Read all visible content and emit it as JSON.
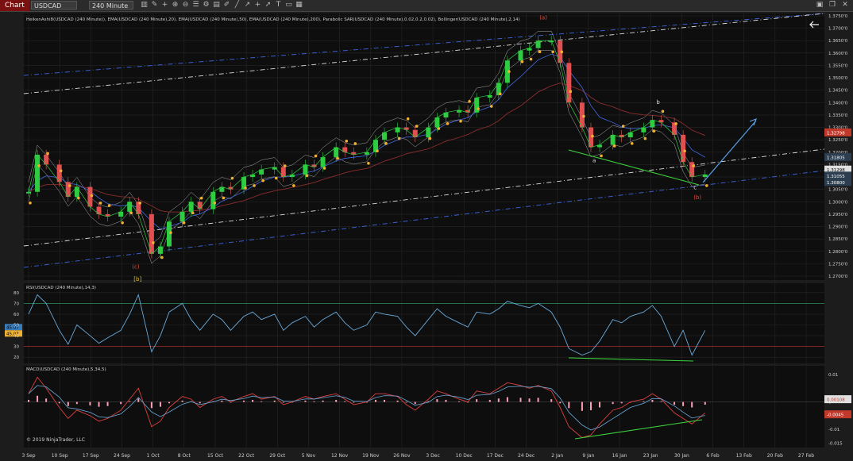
{
  "toolbar": {
    "tab_label": "Chart",
    "symbol": "USDCAD",
    "interval": "240 Minute",
    "icons": [
      "bar-chart-icon",
      "draw-icon",
      "crosshair-icon",
      "zoom-in-icon",
      "zoom-out-icon",
      "properties-icon",
      "strategy-icon",
      "template-icon",
      "pencil-icon",
      "line-icon",
      "ray-icon",
      "plus-icon",
      "arrow-icon",
      "text-icon",
      "shape-icon",
      "grid-icon"
    ],
    "window_icons": [
      "layout-icon",
      "restore-icon",
      "close-icon"
    ]
  },
  "price_panel": {
    "indicator_label": "HeikenAshi8(USDCAD (240 Minute)), EMA(USDCAD (240 Minute),20), EMA(USDCAD (240 Minute),50), EMA(USDCAD (240 Minute),200), Parabolic SAR(USDCAD (240 Minute),0.02,0.2,0.02), Bollinger(USDCAD (240 Minute),2,14)",
    "y_ticks": [
      "1.3750'0",
      "1.3700'0",
      "1.3650'0",
      "1.3600'0",
      "1.3550'0",
      "1.3500'0",
      "1.3450'0",
      "1.3400'0",
      "1.3350'0",
      "1.3300'0",
      "1.3250'0",
      "1.3200'0",
      "1.3150'0",
      "1.3100'0",
      "1.3050'0",
      "1.3000'0",
      "1.2950'0",
      "1.2900'0",
      "1.2850'0",
      "1.2800'0",
      "1.2750'0",
      "1.2700'0"
    ],
    "price_flags": [
      {
        "text": "1.32798",
        "color": "#c0392b",
        "value": 1.32798
      },
      {
        "text": "1.31805",
        "color": "#2c3e50",
        "value": 1.31805
      },
      {
        "text": "1.31298",
        "color": "#e0e0e0",
        "value": 1.31298
      },
      {
        "text": "1.31055",
        "color": "#2c3e50",
        "value": 1.31055
      },
      {
        "text": "1.30800",
        "color": "#2c3e50",
        "value": 1.308
      }
    ],
    "wave_labels": [
      {
        "text": "(a)",
        "color": "#e74c3c"
      },
      {
        "text": "(c)",
        "color": "#e74c3c"
      },
      {
        "text": "[b]",
        "color": "#f1c40f"
      },
      {
        "text": "a",
        "color": "#dddddd"
      },
      {
        "text": "b",
        "color": "#dddddd"
      },
      {
        "text": "c",
        "color": "#dddddd"
      },
      {
        "text": "(b)",
        "color": "#e74c3c"
      }
    ]
  },
  "rsi_panel": {
    "label": "RSI(USDCAD (240 Minute),14,3)",
    "y_ticks": [
      "80",
      "70",
      "60",
      "50",
      "40",
      "30",
      "20"
    ],
    "value_flags": [
      "45.07",
      "45.07"
    ]
  },
  "macd_panel": {
    "label": "MACD(USDCAD (240 Minute),5,34,5)",
    "y_ticks": [
      "0.01",
      "0",
      "-0.01",
      "-0.015"
    ],
    "value_flags": [
      "0.00108",
      "-0.0045"
    ],
    "copyright": "© 2019 NinjaTrader, LLC"
  },
  "x_axis": {
    "labels": [
      "3 Sep",
      "10 Sep",
      "17 Sep",
      "24 Sep",
      "1 Oct",
      "8 Oct",
      "15 Oct",
      "22 Oct",
      "29 Oct",
      "5 Nov",
      "12 Nov",
      "19 Nov",
      "26 Nov",
      "3 Dec",
      "10 Dec",
      "17 Dec",
      "24 Dec",
      "2 Jan",
      "9 Jan",
      "16 Jan",
      "23 Jan",
      "30 Jan",
      "6 Feb",
      "13 Feb",
      "20 Feb",
      "27 Feb"
    ]
  },
  "chart_data": {
    "type": "line",
    "symbol": "USDCAD",
    "interval": "240 Minute",
    "ylim": [
      1.27,
      1.375
    ],
    "price_series": [
      {
        "x": "3 Sep",
        "y": 1.304
      },
      {
        "x": "5 Sep",
        "y": 1.319
      },
      {
        "x": "7 Sep",
        "y": 1.315
      },
      {
        "x": "10 Sep",
        "y": 1.308
      },
      {
        "x": "12 Sep",
        "y": 1.302
      },
      {
        "x": "14 Sep",
        "y": 1.306
      },
      {
        "x": "17 Sep",
        "y": 1.298
      },
      {
        "x": "19 Sep",
        "y": 1.295
      },
      {
        "x": "21 Sep",
        "y": 1.294
      },
      {
        "x": "24 Sep",
        "y": 1.296
      },
      {
        "x": "26 Sep",
        "y": 1.3
      },
      {
        "x": "28 Sep",
        "y": 1.295
      },
      {
        "x": "1 Oct",
        "y": 1.279
      },
      {
        "x": "3 Oct",
        "y": 1.282
      },
      {
        "x": "5 Oct",
        "y": 1.292
      },
      {
        "x": "8 Oct",
        "y": 1.296
      },
      {
        "x": "10 Oct",
        "y": 1.3
      },
      {
        "x": "12 Oct",
        "y": 1.297
      },
      {
        "x": "15 Oct",
        "y": 1.304
      },
      {
        "x": "17 Oct",
        "y": 1.306
      },
      {
        "x": "19 Oct",
        "y": 1.305
      },
      {
        "x": "22 Oct",
        "y": 1.31
      },
      {
        "x": "24 Oct",
        "y": 1.311
      },
      {
        "x": "26 Oct",
        "y": 1.313
      },
      {
        "x": "29 Oct",
        "y": 1.314
      },
      {
        "x": "31 Oct",
        "y": 1.31
      },
      {
        "x": "2 Nov",
        "y": 1.311
      },
      {
        "x": "5 Nov",
        "y": 1.315
      },
      {
        "x": "7 Nov",
        "y": 1.314
      },
      {
        "x": "9 Nov",
        "y": 1.318
      },
      {
        "x": "12 Nov",
        "y": 1.322
      },
      {
        "x": "14 Nov",
        "y": 1.32
      },
      {
        "x": "16 Nov",
        "y": 1.319
      },
      {
        "x": "19 Nov",
        "y": 1.32
      },
      {
        "x": "21 Nov",
        "y": 1.325
      },
      {
        "x": "23 Nov",
        "y": 1.328
      },
      {
        "x": "26 Nov",
        "y": 1.33
      },
      {
        "x": "28 Nov",
        "y": 1.329
      },
      {
        "x": "30 Nov",
        "y": 1.326
      },
      {
        "x": "3 Dec",
        "y": 1.33
      },
      {
        "x": "5 Dec",
        "y": 1.334
      },
      {
        "x": "7 Dec",
        "y": 1.336
      },
      {
        "x": "10 Dec",
        "y": 1.337
      },
      {
        "x": "12 Dec",
        "y": 1.336
      },
      {
        "x": "14 Dec",
        "y": 1.342
      },
      {
        "x": "17 Dec",
        "y": 1.343
      },
      {
        "x": "19 Dec",
        "y": 1.348
      },
      {
        "x": "21 Dec",
        "y": 1.357
      },
      {
        "x": "24 Dec",
        "y": 1.361
      },
      {
        "x": "26 Dec",
        "y": 1.362
      },
      {
        "x": "28 Dec",
        "y": 1.365
      },
      {
        "x": "31 Dec",
        "y": 1.365
      },
      {
        "x": "2 Jan",
        "y": 1.356
      },
      {
        "x": "4 Jan",
        "y": 1.34
      },
      {
        "x": "7 Jan",
        "y": 1.33
      },
      {
        "x": "9 Jan",
        "y": 1.322
      },
      {
        "x": "11 Jan",
        "y": 1.323
      },
      {
        "x": "14 Jan",
        "y": 1.327
      },
      {
        "x": "16 Jan",
        "y": 1.326
      },
      {
        "x": "18 Jan",
        "y": 1.328
      },
      {
        "x": "21 Jan",
        "y": 1.33
      },
      {
        "x": "23 Jan",
        "y": 1.333
      },
      {
        "x": "25 Jan",
        "y": 1.332
      },
      {
        "x": "28 Jan",
        "y": 1.327
      },
      {
        "x": "30 Jan",
        "y": 1.316
      },
      {
        "x": "1 Feb",
        "y": 1.31
      },
      {
        "x": "4 Feb",
        "y": 1.311
      }
    ],
    "rsi_series": [
      {
        "x": "3 Sep",
        "y": 60
      },
      {
        "x": "5 Sep",
        "y": 78
      },
      {
        "x": "7 Sep",
        "y": 70
      },
      {
        "x": "10 Sep",
        "y": 45
      },
      {
        "x": "12 Sep",
        "y": 32
      },
      {
        "x": "14 Sep",
        "y": 50
      },
      {
        "x": "17 Sep",
        "y": 40
      },
      {
        "x": "19 Sep",
        "y": 33
      },
      {
        "x": "21 Sep",
        "y": 38
      },
      {
        "x": "24 Sep",
        "y": 45
      },
      {
        "x": "26 Sep",
        "y": 60
      },
      {
        "x": "28 Sep",
        "y": 78
      },
      {
        "x": "1 Oct",
        "y": 25
      },
      {
        "x": "3 Oct",
        "y": 40
      },
      {
        "x": "5 Oct",
        "y": 62
      },
      {
        "x": "8 Oct",
        "y": 70
      },
      {
        "x": "10 Oct",
        "y": 55
      },
      {
        "x": "12 Oct",
        "y": 45
      },
      {
        "x": "15 Oct",
        "y": 60
      },
      {
        "x": "17 Oct",
        "y": 55
      },
      {
        "x": "19 Oct",
        "y": 45
      },
      {
        "x": "22 Oct",
        "y": 58
      },
      {
        "x": "24 Oct",
        "y": 62
      },
      {
        "x": "26 Oct",
        "y": 55
      },
      {
        "x": "29 Oct",
        "y": 60
      },
      {
        "x": "31 Oct",
        "y": 45
      },
      {
        "x": "2 Nov",
        "y": 52
      },
      {
        "x": "5 Nov",
        "y": 58
      },
      {
        "x": "7 Nov",
        "y": 48
      },
      {
        "x": "9 Nov",
        "y": 55
      },
      {
        "x": "12 Nov",
        "y": 62
      },
      {
        "x": "14 Nov",
        "y": 52
      },
      {
        "x": "16 Nov",
        "y": 45
      },
      {
        "x": "19 Nov",
        "y": 50
      },
      {
        "x": "21 Nov",
        "y": 62
      },
      {
        "x": "23 Nov",
        "y": 60
      },
      {
        "x": "26 Nov",
        "y": 58
      },
      {
        "x": "28 Nov",
        "y": 48
      },
      {
        "x": "30 Nov",
        "y": 40
      },
      {
        "x": "3 Dec",
        "y": 55
      },
      {
        "x": "5 Dec",
        "y": 65
      },
      {
        "x": "7 Dec",
        "y": 58
      },
      {
        "x": "10 Dec",
        "y": 52
      },
      {
        "x": "12 Dec",
        "y": 48
      },
      {
        "x": "14 Dec",
        "y": 62
      },
      {
        "x": "17 Dec",
        "y": 60
      },
      {
        "x": "19 Dec",
        "y": 65
      },
      {
        "x": "21 Dec",
        "y": 72
      },
      {
        "x": "24 Dec",
        "y": 68
      },
      {
        "x": "26 Dec",
        "y": 66
      },
      {
        "x": "28 Dec",
        "y": 70
      },
      {
        "x": "31 Dec",
        "y": 62
      },
      {
        "x": "2 Jan",
        "y": 48
      },
      {
        "x": "4 Jan",
        "y": 28
      },
      {
        "x": "7 Jan",
        "y": 22
      },
      {
        "x": "9 Jan",
        "y": 25
      },
      {
        "x": "11 Jan",
        "y": 35
      },
      {
        "x": "14 Jan",
        "y": 55
      },
      {
        "x": "16 Jan",
        "y": 52
      },
      {
        "x": "18 Jan",
        "y": 58
      },
      {
        "x": "21 Jan",
        "y": 62
      },
      {
        "x": "23 Jan",
        "y": 68
      },
      {
        "x": "25 Jan",
        "y": 58
      },
      {
        "x": "28 Jan",
        "y": 30
      },
      {
        "x": "30 Jan",
        "y": 45
      },
      {
        "x": "1 Feb",
        "y": 22
      },
      {
        "x": "4 Feb",
        "y": 45
      }
    ],
    "macd_series": [
      {
        "x": "3 Sep",
        "y": 0.003
      },
      {
        "x": "5 Sep",
        "y": 0.009
      },
      {
        "x": "7 Sep",
        "y": 0.005
      },
      {
        "x": "10 Sep",
        "y": -0.002
      },
      {
        "x": "12 Sep",
        "y": -0.006
      },
      {
        "x": "14 Sep",
        "y": -0.003
      },
      {
        "x": "17 Sep",
        "y": -0.005
      },
      {
        "x": "19 Sep",
        "y": -0.007
      },
      {
        "x": "21 Sep",
        "y": -0.006
      },
      {
        "x": "24 Sep",
        "y": -0.003
      },
      {
        "x": "26 Sep",
        "y": 0.001
      },
      {
        "x": "28 Sep",
        "y": 0.005
      },
      {
        "x": "1 Oct",
        "y": -0.009
      },
      {
        "x": "3 Oct",
        "y": -0.007
      },
      {
        "x": "5 Oct",
        "y": -0.002
      },
      {
        "x": "8 Oct",
        "y": 0.002
      },
      {
        "x": "10 Oct",
        "y": 0.001
      },
      {
        "x": "12 Oct",
        "y": -0.002
      },
      {
        "x": "15 Oct",
        "y": 0.001
      },
      {
        "x": "17 Oct",
        "y": 0.002
      },
      {
        "x": "19 Oct",
        "y": 0.0
      },
      {
        "x": "22 Oct",
        "y": 0.002
      },
      {
        "x": "24 Oct",
        "y": 0.003
      },
      {
        "x": "26 Oct",
        "y": 0.001
      },
      {
        "x": "29 Oct",
        "y": 0.002
      },
      {
        "x": "31 Oct",
        "y": -0.001
      },
      {
        "x": "2 Nov",
        "y": 0.0
      },
      {
        "x": "5 Nov",
        "y": 0.002
      },
      {
        "x": "7 Nov",
        "y": 0.001
      },
      {
        "x": "9 Nov",
        "y": 0.002
      },
      {
        "x": "12 Nov",
        "y": 0.003
      },
      {
        "x": "14 Nov",
        "y": 0.001
      },
      {
        "x": "16 Nov",
        "y": -0.001
      },
      {
        "x": "19 Nov",
        "y": 0.0
      },
      {
        "x": "21 Nov",
        "y": 0.003
      },
      {
        "x": "23 Nov",
        "y": 0.003
      },
      {
        "x": "26 Nov",
        "y": 0.002
      },
      {
        "x": "28 Nov",
        "y": -0.001
      },
      {
        "x": "30 Nov",
        "y": -0.003
      },
      {
        "x": "3 Dec",
        "y": 0.001
      },
      {
        "x": "5 Dec",
        "y": 0.004
      },
      {
        "x": "7 Dec",
        "y": 0.003
      },
      {
        "x": "10 Dec",
        "y": 0.001
      },
      {
        "x": "12 Dec",
        "y": 0.0
      },
      {
        "x": "14 Dec",
        "y": 0.004
      },
      {
        "x": "17 Dec",
        "y": 0.003
      },
      {
        "x": "19 Dec",
        "y": 0.005
      },
      {
        "x": "21 Dec",
        "y": 0.007
      },
      {
        "x": "24 Dec",
        "y": 0.006
      },
      {
        "x": "26 Dec",
        "y": 0.005
      },
      {
        "x": "28 Dec",
        "y": 0.006
      },
      {
        "x": "31 Dec",
        "y": 0.004
      },
      {
        "x": "2 Jan",
        "y": -0.002
      },
      {
        "x": "4 Jan",
        "y": -0.009
      },
      {
        "x": "7 Jan",
        "y": -0.013
      },
      {
        "x": "9 Jan",
        "y": -0.012
      },
      {
        "x": "11 Jan",
        "y": -0.008
      },
      {
        "x": "14 Jan",
        "y": -0.003
      },
      {
        "x": "16 Jan",
        "y": -0.002
      },
      {
        "x": "18 Jan",
        "y": 0.0
      },
      {
        "x": "21 Jan",
        "y": 0.001
      },
      {
        "x": "23 Jan",
        "y": 0.003
      },
      {
        "x": "25 Jan",
        "y": 0.001
      },
      {
        "x": "28 Jan",
        "y": -0.004
      },
      {
        "x": "30 Jan",
        "y": -0.006
      },
      {
        "x": "1 Feb",
        "y": -0.008
      },
      {
        "x": "4 Feb",
        "y": -0.004
      }
    ],
    "rsi_levels": [
      70,
      30
    ],
    "macd_ylim": [
      -0.016,
      0.012
    ],
    "rsi_ylim": [
      15,
      85
    ]
  }
}
